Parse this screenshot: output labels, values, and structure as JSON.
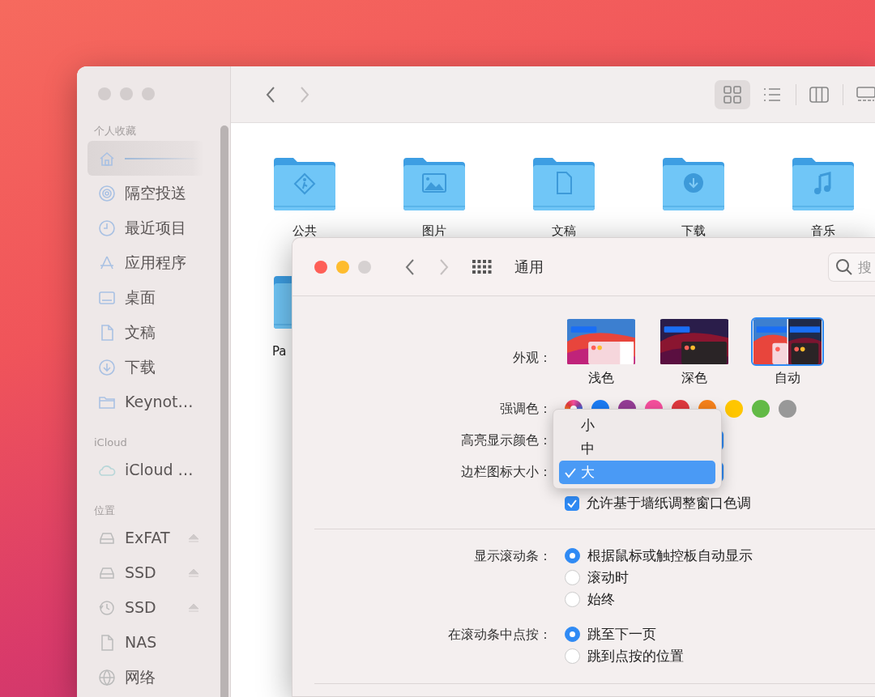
{
  "finder": {
    "toolbar": {
      "forward": {
        "disabled": true
      },
      "views": [
        {
          "selected": true
        },
        {
          "selected": false
        },
        {
          "selected": false
        },
        {
          "selected": false
        }
      ]
    },
    "sidebar": {
      "sections": [
        {
          "title": "个人收藏",
          "items": [
            {
              "selected": true
            },
            {
              "label": "隔空投送",
              "selected": false
            },
            {
              "label": "最近项目",
              "selected": false
            },
            {
              "label": "应用程序",
              "selected": false
            },
            {
              "label": "桌面",
              "selected": false
            },
            {
              "label": "文稿",
              "selected": false
            },
            {
              "label": "下载",
              "selected": false
            },
            {
              "label": "Keynot…",
              "selected": false
            }
          ]
        },
        {
          "title": "iCloud",
          "items": [
            {
              "label": "iCloud …",
              "selected": false
            }
          ]
        },
        {
          "title": "位置",
          "items": [
            {
              "label": "ExFAT",
              "selected": false,
              "eject": true
            },
            {
              "label": "SSD",
              "selected": false,
              "eject": true
            },
            {
              "label": "SSD",
              "selected": false,
              "eject": true
            },
            {
              "label": "NAS",
              "selected": false
            },
            {
              "label": "网络",
              "selected": false
            }
          ]
        }
      ]
    },
    "folders": [
      {
        "label": "公共"
      },
      {
        "label": "图片"
      },
      {
        "label": "文稿"
      },
      {
        "label": "下载"
      },
      {
        "label": "音乐"
      },
      {
        "label": "Pa"
      }
    ]
  },
  "preferences": {
    "title": "通用",
    "forward": {
      "disabled": true
    },
    "search": {
      "placeholder": "搜"
    },
    "appearance": {
      "label": "外观：",
      "options": [
        {
          "label": "浅色",
          "kind": "light",
          "selected": false
        },
        {
          "label": "深色",
          "kind": "dark",
          "selected": false
        },
        {
          "label": "自动",
          "kind": "auto",
          "selected": true
        }
      ]
    },
    "accent": {
      "label": "强调色：",
      "colors": [
        {
          "kind": "multicolor",
          "selected": true
        },
        {
          "kind": "solid",
          "color": "#1a7cf5",
          "selected": false
        },
        {
          "kind": "solid",
          "color": "#953d96",
          "selected": false
        },
        {
          "kind": "solid",
          "color": "#f74f9e",
          "selected": false
        },
        {
          "kind": "solid",
          "color": "#e0383e",
          "selected": false
        },
        {
          "kind": "solid",
          "color": "#f7821b",
          "selected": false
        },
        {
          "kind": "solid",
          "color": "#ffc600",
          "selected": false
        },
        {
          "kind": "solid",
          "color": "#62ba46",
          "selected": false
        },
        {
          "kind": "solid",
          "color": "#989898",
          "selected": false
        }
      ]
    },
    "highlight": {
      "label": "高亮显示颜色："
    },
    "sidebar_icon_size": {
      "label": "边栏图标大小：",
      "menu": [
        {
          "label": "小",
          "selected": false
        },
        {
          "label": "中",
          "selected": false
        },
        {
          "label": "大",
          "selected": true
        }
      ]
    },
    "wallpaper_tint": {
      "label": "允许基于墙纸调整窗口色调",
      "checked": true
    },
    "show_scroll_bars": {
      "label": "显示滚动条：",
      "options": [
        {
          "label": "根据鼠标或触控板自动显示",
          "selected": true
        },
        {
          "label": "滚动时",
          "selected": false
        },
        {
          "label": "始终",
          "selected": false
        }
      ]
    },
    "click_scroll_bar": {
      "label": "在滚动条中点按：",
      "options": [
        {
          "label": "跳至下一页",
          "selected": true
        },
        {
          "label": "跳到点按的位置",
          "selected": false
        }
      ]
    }
  }
}
